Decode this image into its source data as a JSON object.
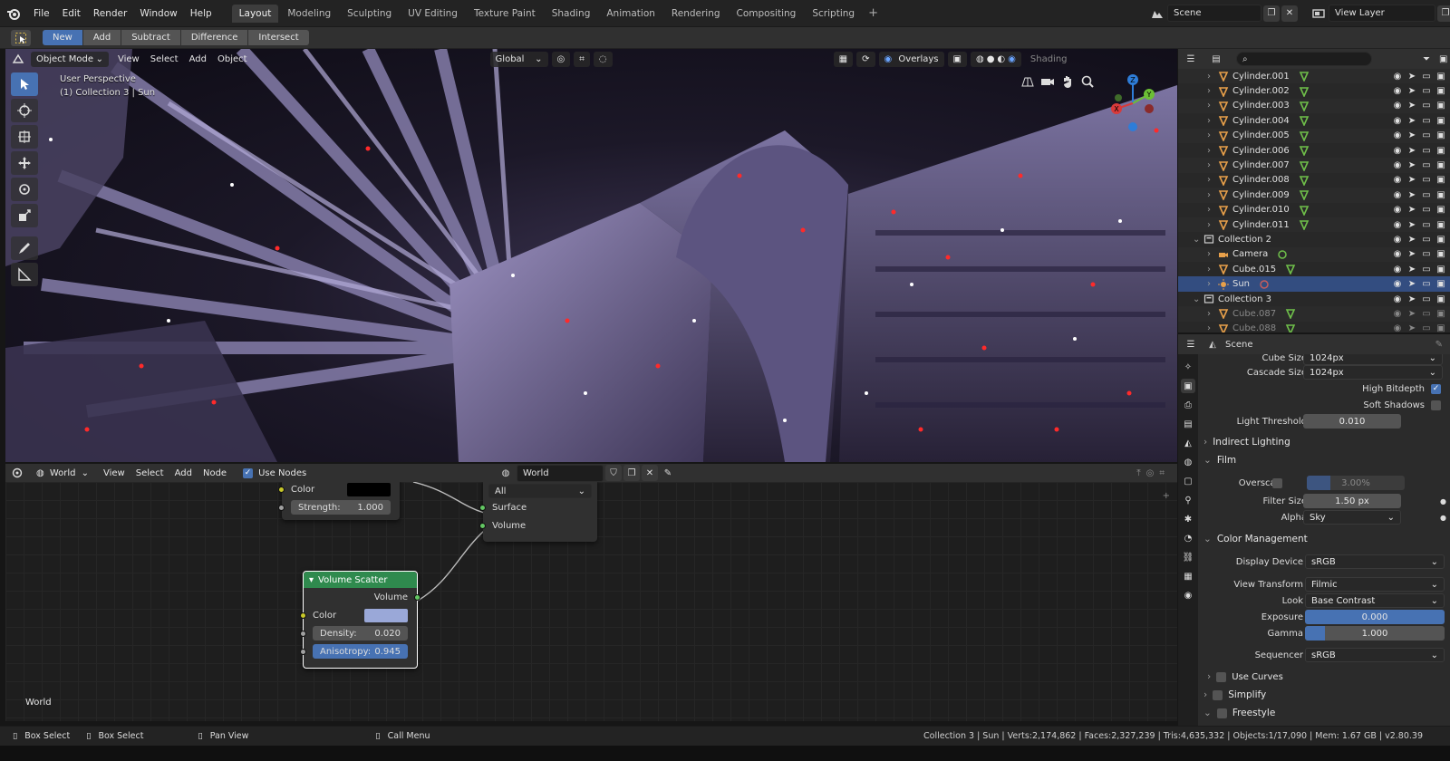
{
  "menubar": {
    "items": [
      "File",
      "Edit",
      "Render",
      "Window",
      "Help"
    ],
    "workspaces": [
      "Layout",
      "Modeling",
      "Sculpting",
      "UV Editing",
      "Texture Paint",
      "Shading",
      "Animation",
      "Rendering",
      "Compositing",
      "Scripting"
    ],
    "active_workspace": "Layout",
    "add_workspace": "+",
    "scene": "Scene",
    "view_layer": "View Layer"
  },
  "tool_header": {
    "modes": [
      "New",
      "Add",
      "Subtract",
      "Difference",
      "Intersect"
    ],
    "active_mode": "New"
  },
  "viewport": {
    "mode": "Object Mode",
    "menus": [
      "View",
      "Select",
      "Add",
      "Object"
    ],
    "orientation": "Global",
    "overlays": "Overlays",
    "shading": "Shading",
    "perspective_label": "User Perspective",
    "collection_label": "(1) Collection 3 | Sun"
  },
  "node_editor": {
    "world_type": "World",
    "menus": [
      "View",
      "Select",
      "Add",
      "Node"
    ],
    "use_nodes": "Use Nodes",
    "datablock": "World",
    "background_node": {
      "color_label": "Color",
      "strength_label": "Strength:",
      "strength_value": "1.000"
    },
    "output_node": {
      "target": "All",
      "surface": "Surface",
      "volume": "Volume"
    },
    "volume_scatter": {
      "title": "Volume Scatter",
      "volume": "Volume",
      "color_label": "Color",
      "density_label": "Density:",
      "density_value": "0.020",
      "anisotropy_label": "Anisotropy:",
      "anisotropy_value": "0.945"
    },
    "footer_label": "World"
  },
  "outliner": {
    "rows": [
      {
        "name": "Cylinder.001",
        "indent": 2,
        "type": "mesh"
      },
      {
        "name": "Cylinder.002",
        "indent": 2,
        "type": "mesh"
      },
      {
        "name": "Cylinder.003",
        "indent": 2,
        "type": "mesh"
      },
      {
        "name": "Cylinder.004",
        "indent": 2,
        "type": "mesh"
      },
      {
        "name": "Cylinder.005",
        "indent": 2,
        "type": "mesh"
      },
      {
        "name": "Cylinder.006",
        "indent": 2,
        "type": "mesh"
      },
      {
        "name": "Cylinder.007",
        "indent": 2,
        "type": "mesh"
      },
      {
        "name": "Cylinder.008",
        "indent": 2,
        "type": "mesh"
      },
      {
        "name": "Cylinder.009",
        "indent": 2,
        "type": "mesh"
      },
      {
        "name": "Cylinder.010",
        "indent": 2,
        "type": "mesh"
      },
      {
        "name": "Cylinder.011",
        "indent": 2,
        "type": "mesh"
      },
      {
        "name": "Collection 2",
        "indent": 1,
        "type": "collection"
      },
      {
        "name": "Camera",
        "indent": 2,
        "type": "camera"
      },
      {
        "name": "Cube.015",
        "indent": 2,
        "type": "mesh"
      },
      {
        "name": "Sun",
        "indent": 2,
        "type": "light",
        "selected": true
      },
      {
        "name": "Collection 3",
        "indent": 1,
        "type": "collection"
      },
      {
        "name": "Cube.087",
        "indent": 2,
        "type": "mesh",
        "dim": true
      },
      {
        "name": "Cube.088",
        "indent": 2,
        "type": "mesh",
        "dim": true
      }
    ]
  },
  "properties": {
    "context": "Scene",
    "cube_size_label": "Cube Size",
    "cube_size": "1024px",
    "cascade_size_label": "Cascade Size",
    "cascade_size": "1024px",
    "high_bitdepth": "High Bitdepth",
    "soft_shadows": "Soft Shadows",
    "light_threshold_label": "Light Threshold",
    "light_threshold": "0.010",
    "indirect_lighting": "Indirect Lighting",
    "film": "Film",
    "overscan_label": "Overscan",
    "overscan": "3.00%",
    "filter_size_label": "Filter Size",
    "filter_size": "1.50 px",
    "alpha_label": "Alpha",
    "alpha": "Sky",
    "color_management": "Color Management",
    "display_device_label": "Display Device",
    "display_device": "sRGB",
    "view_transform_label": "View Transform",
    "view_transform": "Filmic",
    "look_label": "Look",
    "look": "Base Contrast",
    "exposure_label": "Exposure",
    "exposure": "0.000",
    "gamma_label": "Gamma",
    "gamma": "1.000",
    "sequencer_label": "Sequencer",
    "sequencer": "sRGB",
    "use_curves": "Use Curves",
    "simplify": "Simplify",
    "freestyle": "Freestyle"
  },
  "statusbar": {
    "hint1": "Box Select",
    "hint2": "Box Select",
    "hint3": "Pan View",
    "hint4": "Call Menu",
    "stats": "Collection 3 | Sun | Verts:2,174,862 | Faces:2,327,239 | Tris:4,635,332 | Objects:1/17,090 | Mem: 1.67 GB | v2.80.39"
  },
  "colors": {
    "accent": "#4772b3",
    "mesh_icon": "#6fbf4a",
    "object_icon": "#e8a04a",
    "volume_scatter_header": "#2f8a4e"
  }
}
